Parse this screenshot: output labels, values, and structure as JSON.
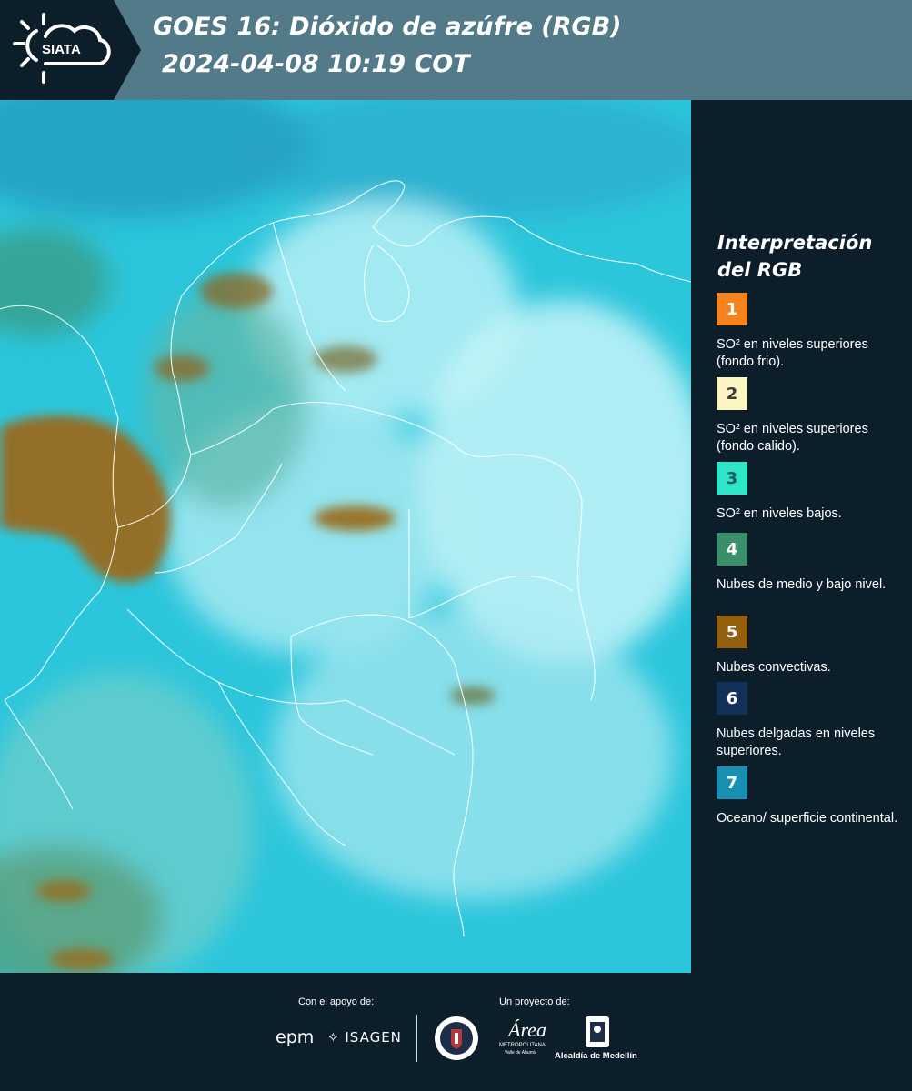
{
  "header": {
    "logo_text": "SIATA",
    "title_line1": "GOES 16: Dióxido de azúfre (RGB)",
    "title_line2": "2024-04-08 10:19 COT"
  },
  "legend": {
    "title": "Interpretación del RGB",
    "items": [
      {
        "number": "1",
        "color": "#f4821f",
        "number_color": "#ffffff",
        "text": "SO² en niveles superiores (fondo frio)."
      },
      {
        "number": "2",
        "color": "#fdf6c3",
        "number_color": "#3a3a3a",
        "text": "SO² en niveles superiores (fondo calido)."
      },
      {
        "number": "3",
        "color": "#2ee6c8",
        "number_color": "#1c5a55",
        "text": "SO² en niveles bajos."
      },
      {
        "number": "4",
        "color": "#3a8f6a",
        "number_color": "#ffffff",
        "text": "Nubes de medio y bajo nivel."
      },
      {
        "number": "5",
        "color": "#94600f",
        "number_color": "#ffffff",
        "text": "Nubes convectivas."
      },
      {
        "number": "6",
        "color": "#11305a",
        "number_color": "#ffffff",
        "text": "Nubes delgadas en niveles superiores."
      },
      {
        "number": "7",
        "color": "#1a8fb4",
        "number_color": "#ffffff",
        "text": "Oceano/ superficie continental."
      }
    ]
  },
  "footer": {
    "support_label": "Con el apoyo de:",
    "project_label": "Un proyecto de:",
    "epm": "epm",
    "isagen": "ISAGEN",
    "area_main": "Área",
    "area_sub": "METROPOLITANA",
    "area_sub2": "Valle de Aburrá",
    "alcaldia": "Alcaldía de Medellín"
  },
  "map": {
    "ocean_color": "#2fc9dc",
    "cloud_color": "#c9f3f7",
    "convective_color": "#9a6a1a",
    "border_color": "#ffffff"
  }
}
